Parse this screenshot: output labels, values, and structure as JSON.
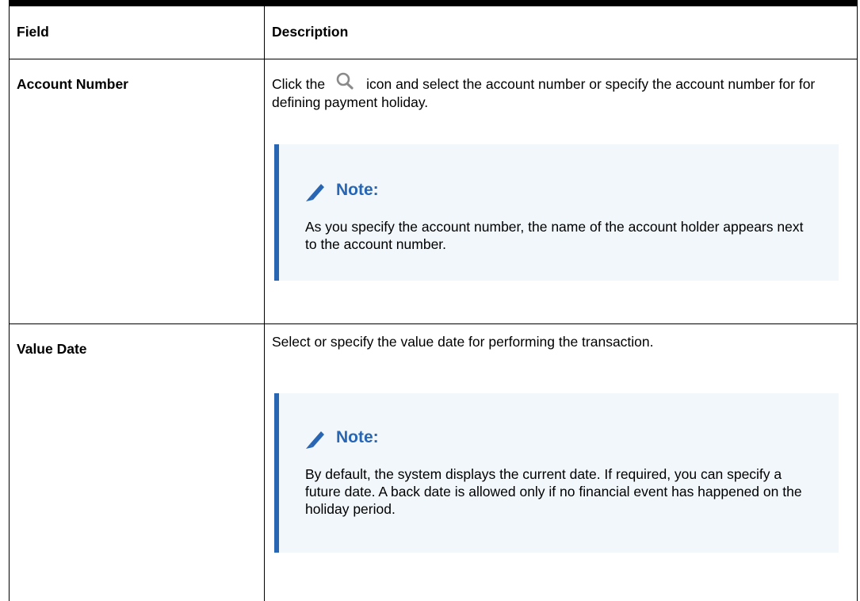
{
  "table": {
    "headers": {
      "field": "Field",
      "description": "Description"
    },
    "rows": [
      {
        "field": "Account Number",
        "desc_before_icon": "Click the",
        "icon": "search-icon",
        "desc_after_icon": "icon and select the account number or specify the account number for for defining payment holiday.",
        "note": {
          "title": "Note:",
          "text": "As you specify the account number, the name of the account holder appears next to the account number."
        }
      },
      {
        "field": "Value Date",
        "description": "Select or specify the value date for performing the transaction.",
        "note": {
          "title": "Note:",
          "text": "By default, the system displays the current date. If required, you can specify a future date. A back date is allowed only if no financial event has happened on the holiday period."
        }
      }
    ]
  },
  "colors": {
    "note_accent": "#2865b3",
    "note_background": "#f1f7fb"
  }
}
